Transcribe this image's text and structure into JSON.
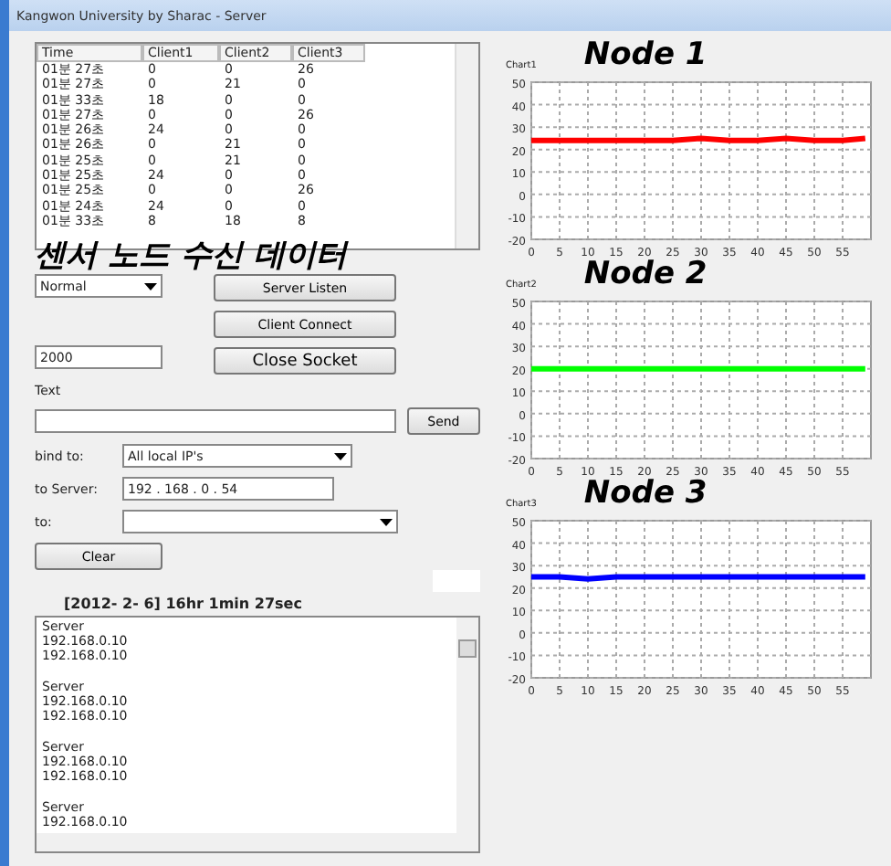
{
  "window": {
    "title": "Kangwon University by Sharac - Server"
  },
  "table": {
    "columns": [
      "Time",
      "Client1",
      "Client2",
      "Client3"
    ],
    "rows": [
      [
        "01분 27초",
        "0",
        "0",
        "26"
      ],
      [
        "01분 27초",
        "0",
        "21",
        "0"
      ],
      [
        "01분 33초",
        "18",
        "0",
        "0"
      ],
      [
        "01분 27초",
        "0",
        "0",
        "26"
      ],
      [
        "01분 26초",
        "24",
        "0",
        "0"
      ],
      [
        "01분 26초",
        "0",
        "21",
        "0"
      ],
      [
        "01분 25초",
        "0",
        "21",
        "0"
      ],
      [
        "01분 25초",
        "24",
        "0",
        "0"
      ],
      [
        "01분 25초",
        "0",
        "0",
        "26"
      ],
      [
        "01분 24초",
        "24",
        "0",
        "0"
      ],
      [
        "01분 33초",
        "8",
        "18",
        "8"
      ]
    ]
  },
  "heading": "센서 노드 수신 데이터",
  "controls": {
    "mode": "Normal",
    "server_listen": "Server Listen",
    "client_connect": "Client Connect",
    "port": "2000",
    "close_socket": "Close Socket",
    "text_label": "Text",
    "send": "Send",
    "bind_label": "bind to:",
    "bind_value": "All local IP's",
    "server_label": "to Server:",
    "server_ip": "192 . 168 . 0 . 54",
    "to_label": "to:",
    "clear": "Clear"
  },
  "timestamp": "[2012- 2- 6] 16hr 1min 27sec",
  "log": [
    {
      "name": "Server",
      "lines": [
        "192.168.0.10",
        "192.168.0.10"
      ]
    },
    {
      "name": "Server",
      "lines": [
        "192.168.0.10",
        "192.168.0.10"
      ]
    },
    {
      "name": "Server",
      "lines": [
        "192.168.0.10",
        "192.168.0.10"
      ]
    },
    {
      "name": "Server",
      "lines": [
        "192.168.0.10"
      ]
    }
  ],
  "charts": [
    {
      "caption": "Chart1",
      "chart_data": {
        "type": "line",
        "grid": true,
        "x": [
          0,
          5,
          10,
          15,
          20,
          25,
          30,
          35,
          40,
          45,
          50,
          55,
          59
        ],
        "series": [
          {
            "name": "Node 1",
            "color": "#ff0000",
            "values": [
              24,
              24,
              24,
              24,
              24,
              24,
              25,
              24,
              24,
              25,
              24,
              24,
              25
            ]
          }
        ],
        "ylim": [
          -20,
          50
        ],
        "xlim": [
          0,
          60
        ],
        "yticks": [
          -20,
          -10,
          0,
          10,
          20,
          30,
          40,
          50
        ],
        "xticks": [
          0,
          5,
          10,
          15,
          20,
          25,
          30,
          35,
          40,
          45,
          50,
          55
        ]
      }
    },
    {
      "caption": "Chart2",
      "chart_data": {
        "type": "line",
        "grid": true,
        "x": [
          0,
          5,
          10,
          15,
          20,
          25,
          30,
          35,
          40,
          45,
          50,
          55,
          59
        ],
        "series": [
          {
            "name": "Node 2",
            "color": "#00ff00",
            "values": [
              20,
              20,
              20,
              20,
              20,
              20,
              20,
              20,
              20,
              20,
              20,
              20,
              20
            ]
          }
        ],
        "ylim": [
          -20,
          50
        ],
        "xlim": [
          0,
          60
        ],
        "yticks": [
          -20,
          -10,
          0,
          10,
          20,
          30,
          40,
          50
        ],
        "xticks": [
          0,
          5,
          10,
          15,
          20,
          25,
          30,
          35,
          40,
          45,
          50,
          55
        ]
      }
    },
    {
      "caption": "Chart3",
      "chart_data": {
        "type": "line",
        "grid": true,
        "x": [
          0,
          5,
          10,
          15,
          20,
          25,
          30,
          35,
          40,
          45,
          50,
          55,
          59
        ],
        "series": [
          {
            "name": "Node 3",
            "color": "#0000ff",
            "values": [
              25,
              25,
              24,
              25,
              25,
              25,
              25,
              25,
              25,
              25,
              25,
              25,
              25
            ]
          }
        ],
        "ylim": [
          -20,
          50
        ],
        "xlim": [
          0,
          60
        ],
        "yticks": [
          -20,
          -10,
          0,
          10,
          20,
          30,
          40,
          50
        ],
        "xticks": [
          0,
          5,
          10,
          15,
          20,
          25,
          30,
          35,
          40,
          45,
          50,
          55
        ]
      }
    }
  ]
}
